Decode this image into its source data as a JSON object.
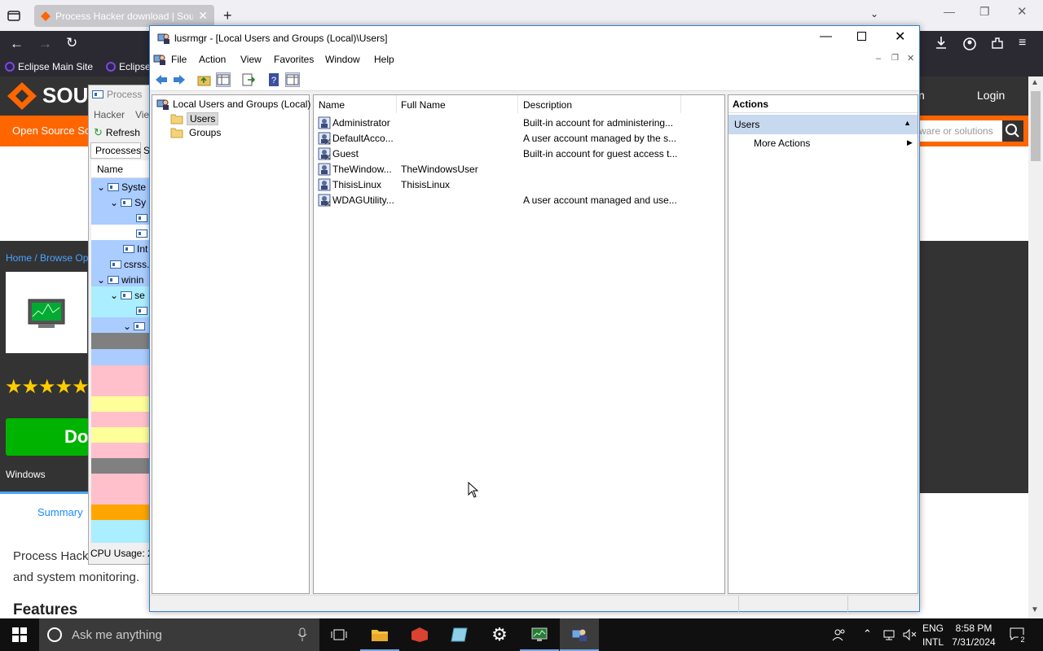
{
  "browser": {
    "tab_title": "Process Hacker download | Sou",
    "bookmarks": [
      "Eclipse Main Site",
      "Eclipse"
    ],
    "site": {
      "logo_text": "SOU",
      "login_label": "Login",
      "nav_partial": "n",
      "search_placeholder": "ware or solutions",
      "orange_text": "Open Source So",
      "breadcrumb": "Home / Browse Op",
      "download_label": "Do",
      "os_label": "Windows",
      "summary_tab": "Summary",
      "description_line1": "Process Hack",
      "description_line2": "and system monitoring.",
      "features_heading": "Features",
      "stars": "★★★★★"
    }
  },
  "process_hacker": {
    "title": "Process",
    "menu": [
      "Hacker",
      "Vie"
    ],
    "refresh_label": "Refresh",
    "tabs": [
      "Processes",
      "S"
    ],
    "column_name": "Name",
    "rows": [
      "Syste",
      "Sy",
      "",
      "",
      "Int",
      "csrss.",
      "winin",
      "se",
      "",
      ""
    ],
    "cpu_usage": "CPU Usage: 2."
  },
  "window": {
    "title": "lusrmgr - [Local Users and Groups (Local)\\Users]",
    "menu": [
      "File",
      "Action",
      "View",
      "Favorites",
      "Window",
      "Help"
    ],
    "tree": {
      "root": "Local Users and Groups (Local)",
      "children": [
        "Users",
        "Groups"
      ],
      "selected": "Users"
    },
    "list": {
      "columns": [
        "Name",
        "Full Name",
        "Description"
      ],
      "rows": [
        {
          "name": "Administrator",
          "full_name": "",
          "description": "Built-in account for administering..."
        },
        {
          "name": "DefaultAcco...",
          "full_name": "",
          "description": "A user account managed by the s..."
        },
        {
          "name": "Guest",
          "full_name": "",
          "description": "Built-in account for guest access t..."
        },
        {
          "name": "TheWindow...",
          "full_name": "TheWindowsUser",
          "description": ""
        },
        {
          "name": "ThisisLinux",
          "full_name": "ThisisLinux",
          "description": ""
        },
        {
          "name": "WDAGUtility...",
          "full_name": "",
          "description": "A user account managed and use..."
        }
      ]
    },
    "actions": {
      "header": "Actions",
      "section": "Users",
      "items": [
        "More Actions"
      ]
    }
  },
  "taskbar": {
    "search_placeholder": "Ask me anything",
    "language": "ENG",
    "layout": "INTL",
    "time": "8:58 PM",
    "date": "7/31/2024",
    "notification_count": "2"
  },
  "colors": {
    "accent_orange": "#ff6600",
    "download_green": "#00b300",
    "selection_blue": "#cce8ff",
    "action_section": "#c7d9ee"
  }
}
